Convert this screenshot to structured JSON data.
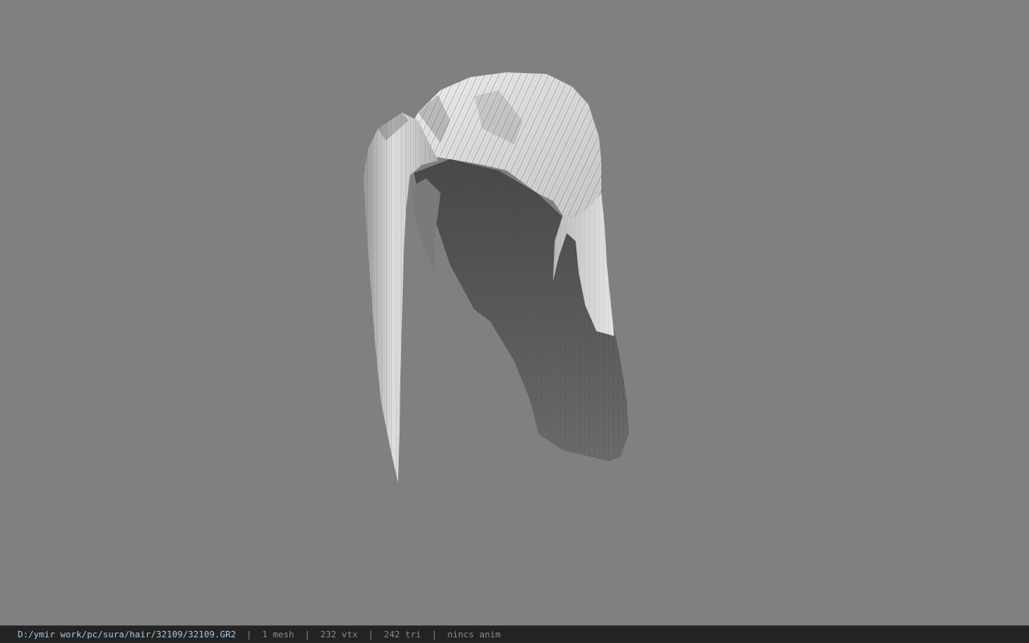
{
  "viewport": {
    "model_name": "hair mesh preview",
    "background_color": "#808080"
  },
  "statusbar": {
    "file_path": "D:/ymir work/pc/sura/hair/32109/32109.GR2",
    "mesh_count": "1 mesh",
    "vertex_count": "232 vtx",
    "triangle_count": "242 tri",
    "anim_status": "nincs anim",
    "separator": "|",
    "accent_color": "#9ecbe6"
  }
}
